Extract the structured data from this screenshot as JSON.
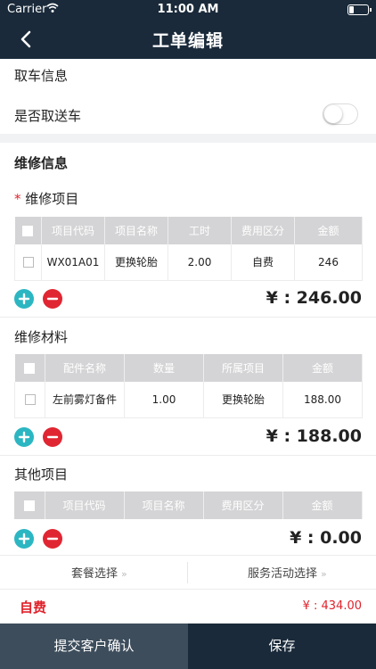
{
  "status_bar": {
    "carrier": "Carrier",
    "time": "11:00 AM"
  },
  "nav": {
    "title": "工单编辑"
  },
  "pickup": {
    "title": "取车信息",
    "pickup_label": "是否取送车",
    "pickup_enabled": false
  },
  "repair": {
    "title": "维修信息",
    "items": {
      "required_mark": "*",
      "label": "维修项目",
      "headers": [
        "项目代码",
        "项目名称",
        "工时",
        "费用区分",
        "金额"
      ],
      "rows": [
        {
          "code": "WX01A01",
          "name": "更换轮胎",
          "hours": "2.00",
          "fee_type": "自费",
          "amount": "246"
        }
      ],
      "total": "¥ : 246.00"
    },
    "materials": {
      "label": "维修材料",
      "headers": [
        "配件名称",
        "数量",
        "所属项目",
        "金额"
      ],
      "rows": [
        {
          "part": "左前雾灯备件",
          "qty": "1.00",
          "project": "更换轮胎",
          "amount": "188.00"
        }
      ],
      "total": "¥ : 188.00"
    },
    "other": {
      "label": "其他项目",
      "headers": [
        "项目代码",
        "项目名称",
        "费用区分",
        "金额"
      ],
      "rows": [],
      "total": "¥ : 0.00"
    }
  },
  "packages": {
    "package_label": "套餐选择",
    "service_label": "服务活动选择",
    "arrow": "»"
  },
  "summary": {
    "fee_type": "自费",
    "amount": "¥ : 434.00"
  },
  "footer": {
    "confirm_label": "提交客户确认",
    "save_label": "保存"
  },
  "colors": {
    "nav_bg": "#1a2a3a",
    "accent_red": "#e0222b",
    "plus_teal": "#2bb6c2",
    "footer_left": "#3d4d5c",
    "footer_right": "#1a2a3a"
  }
}
